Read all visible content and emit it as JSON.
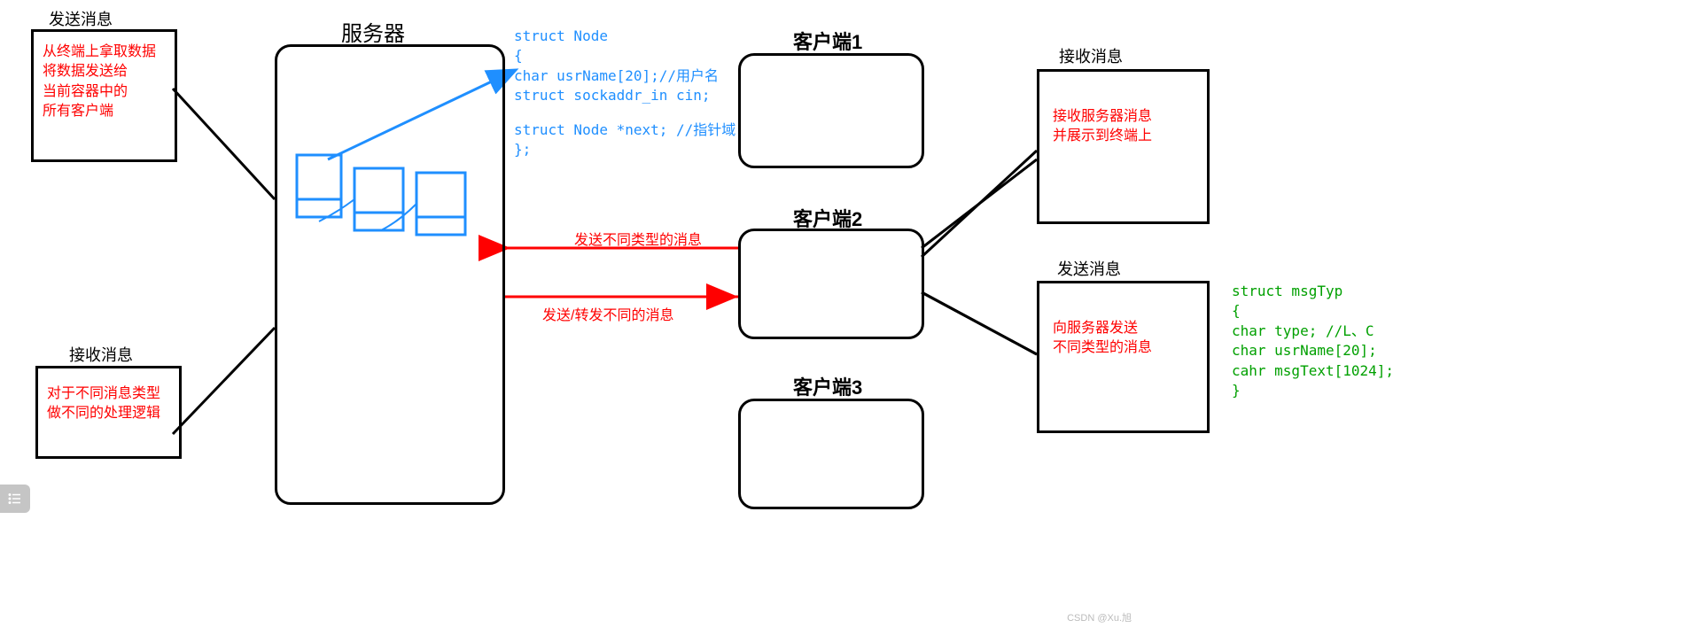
{
  "titles": {
    "send_left": "发送消息",
    "recv_left": "接收消息",
    "server": "服务器",
    "client1": "客户端1",
    "client2": "客户端2",
    "client3": "客户端3",
    "recv_right": "接收消息",
    "send_right": "发送消息"
  },
  "texts": {
    "send_left_l1": "从终端上拿取数据",
    "send_left_l2": "将数据发送给",
    "send_left_l3": "当前容器中的",
    "send_left_l4": "所有客户端",
    "recv_left_l1": "对于不同消息类型",
    "recv_left_l2": "做不同的处理逻辑",
    "recv_right_l1": "接收服务器消息",
    "recv_right_l2": "并展示到终端上",
    "send_right_l1": "向服务器发送",
    "send_right_l2": "不同类型的消息",
    "arrow_top": "发送不同类型的消息",
    "arrow_bottom": "发送/转发不同的消息"
  },
  "code_node": {
    "l1": "struct Node",
    "l2": "{",
    "l3": "  char usrName[20];//用户名",
    "l4": "  struct sockaddr_in cin;",
    "l5": "",
    "l6": "  struct Node *next;  //指针域",
    "l7": "};"
  },
  "code_msg": {
    "l1": "struct msgTyp",
    "l2": "{",
    "l3": "  char type;   //L、C",
    "l4": "  char usrName[20];",
    "l5": "  cahr msgText[1024];",
    "l6": "}"
  },
  "watermark": "CSDN @Xu.旭"
}
